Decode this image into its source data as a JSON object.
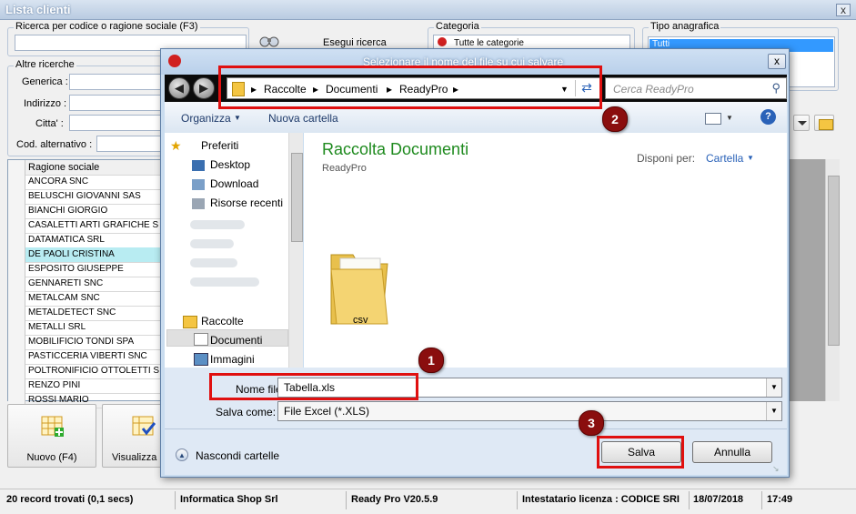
{
  "window": {
    "title": "Lista clienti",
    "close": "x"
  },
  "search": {
    "legend": "Ricerca per codice o ragione sociale (F3)",
    "value": "",
    "button": "Esegui ricerca"
  },
  "category": {
    "legend": "Categoria",
    "selected": "Tutte le categorie"
  },
  "tipo": {
    "legend": "Tipo anagrafica",
    "selected": "Tutti"
  },
  "altre": {
    "legend": "Altre ricerche",
    "fields": [
      {
        "label": "Generica :",
        "value": ""
      },
      {
        "label": "Indirizzo :",
        "value": ""
      },
      {
        "label": "Citta' :",
        "value": ""
      },
      {
        "label": "Cod. alternativo :",
        "value": ""
      }
    ]
  },
  "grid": {
    "header": "Ragione sociale",
    "rows": [
      "ANCORA SNC",
      "BELUSCHI GIOVANNI SAS",
      "BIANCHI GIORGIO",
      "CASALETTI ARTI GRAFICHE S",
      "DATAMATICA SRL",
      "DE PAOLI CRISTINA",
      "ESPOSITO GIUSEPPE",
      "GENNARETI SNC",
      "METALCAM SNC",
      "METALDETECT SNC",
      "METALLI SRL",
      "MOBILIFICIO TONDI SPA",
      "PASTICCERIA VIBERTI SNC",
      "POLTRONIFICIO OTTOLETTI S",
      "RENZO PINI",
      "ROSSI MARIO"
    ],
    "selected_index": 5
  },
  "bottom_buttons": {
    "new": "Nuovo (F4)",
    "view": "Visualizza ("
  },
  "status": {
    "records": "20 record trovati (0,1 secs)",
    "company": "Informatica Shop Srl",
    "version": "Ready Pro V20.5.9",
    "license": "Intestatario licenza : CODICE SRI",
    "date": "18/07/2018",
    "time": "17:49"
  },
  "dialog": {
    "title": "Selezionare il nome del file su cui salvare",
    "close": "x",
    "breadcrumb": [
      "Raccolte",
      "Documenti",
      "ReadyPro"
    ],
    "search_placeholder": "Cerca ReadyPro",
    "toolbar": {
      "organize": "Organizza",
      "new_folder": "Nuova cartella",
      "help": "?"
    },
    "nav": {
      "favorites": "Preferiti",
      "favorites_items": [
        "Desktop",
        "Download",
        "Risorse recenti"
      ],
      "libraries": "Raccolte",
      "libraries_items": [
        "Documenti",
        "Immagini"
      ]
    },
    "content": {
      "title": "Raccolta Documenti",
      "subtitle": "ReadyPro",
      "arrange_label": "Disponi per:",
      "arrange_value": "Cartella",
      "folder_name": "csv"
    },
    "filename_label": "Nome file:",
    "filename_value": "Tabella.xls",
    "type_label": "Salva come:",
    "type_value": "File Excel (*.XLS)",
    "hide_folders": "Nascondi cartelle",
    "save": "Salva",
    "cancel": "Annulla"
  },
  "badges": [
    "1",
    "2",
    "3"
  ],
  "colors": {
    "highlight_red": "#e01010",
    "badge": "#8a0e0e",
    "selected_row": "#b8ecf2",
    "accent_green": "#1e8a1e"
  }
}
